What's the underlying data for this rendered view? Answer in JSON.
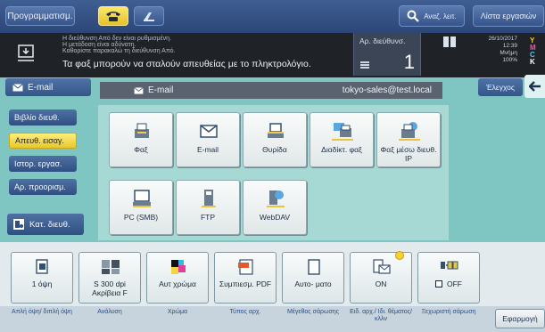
{
  "topbar": {
    "program_label": "Προγραμματισμ.",
    "search_label": "Αναζ. λειτ.",
    "joblist_label": "Λίστα εργασιών"
  },
  "message": {
    "line1": "Η διεύθυνση Από δεν είναι ρυθμισμένη.",
    "line2": "Η μετάδοση είναι αδύνατη.",
    "line3": "Καθορίστε παρακαλώ τη διεύθυνση Από.",
    "main": "Τα φαξ μπορούν να σταλούν απευθείας με το πληκτρολόγιο."
  },
  "destination_count": {
    "label": "Αρ. διεύθυνσ.",
    "value": "1"
  },
  "status": {
    "date": "26/10/2017",
    "time": "12:39",
    "memory_label": "Μνήμη",
    "memory_value": "100%",
    "toner_y": "Y",
    "toner_m": "M",
    "toner_c": "C",
    "toner_k": "K"
  },
  "mode_tab": {
    "label": "E-mail"
  },
  "address_bar": {
    "mode": "E-mail",
    "address": "tokyo-sales@test.local"
  },
  "check_button": "Έλεγχος",
  "sidebar": {
    "items": [
      {
        "label": "Βιβλίο διευθ."
      },
      {
        "label": "Απευθ. εισαγ."
      },
      {
        "label": "Ιστορ. εργασ."
      },
      {
        "label": "Αρ. προορισμ."
      }
    ],
    "search_label": "Κατ. διευθ."
  },
  "destinations": [
    {
      "label": "Φαξ",
      "icon": "fax-icon"
    },
    {
      "label": "E-mail",
      "icon": "envelope-icon"
    },
    {
      "label": "Θυρίδα",
      "icon": "user-box-icon"
    },
    {
      "label": "Διαδίκτ. φαξ",
      "icon": "internet-fax-icon"
    },
    {
      "label": "Φαξ μέσω διευθ. IP",
      "icon": "ip-fax-icon"
    },
    {
      "label": "PC (SMB)",
      "icon": "pc-icon"
    },
    {
      "label": "FTP",
      "icon": "ftp-server-icon"
    },
    {
      "label": "WebDAV",
      "icon": "webdav-icon"
    }
  ],
  "settings": [
    {
      "value": "1 όψη",
      "label": "Απλή όψη/ διπλή όψη",
      "icon": "simplex-icon"
    },
    {
      "value": "S 300 dpi Ακρίβεια F",
      "label": "Ανάλυση",
      "icon": "resolution-icon"
    },
    {
      "value": "Αυτ χρώμα",
      "label": "Χρώμα",
      "icon": "color-icon"
    },
    {
      "value": "Συμπιεσμ. PDF",
      "label": "Τύπος αρχ.",
      "icon": "pdf-icon"
    },
    {
      "value": "Αυτο- ματο",
      "label": "Μέγεθος σάρωσης",
      "icon": "scan-size-icon"
    },
    {
      "value": "ON",
      "label": "Ειδ. αρχ./ Ιδι. θέματος/ κλλν",
      "icon": "email-notify-icon"
    },
    {
      "value": "OFF",
      "label": "Ξεχωριστή σάρωση",
      "icon": "separate-scan-icon"
    }
  ],
  "apply_button": "Εφαρμογή"
}
